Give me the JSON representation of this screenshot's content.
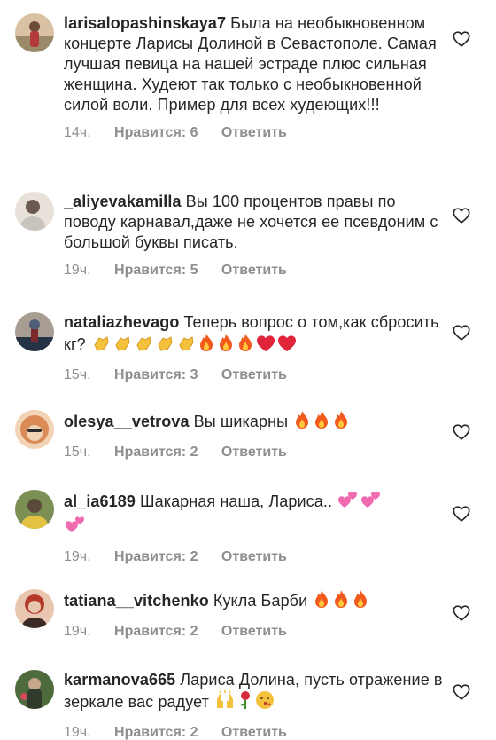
{
  "comments": [
    {
      "username": "larisalopashinskaya7",
      "text": "Была на необыкновенном концерте Ларисы Долиной в Севастополе. Самая лучшая певица на нашей эстраде плюс сильная женщина. Худеют так только с необыкновенной силой воли. Пример для всех худеющих!!!",
      "time": "14ч.",
      "likes": "Нравится: 6",
      "reply": "Ответить",
      "avatar_colors": [
        "#b08f6a",
        "#6c4a3a",
        "#d9c2a4"
      ]
    },
    {
      "username": "_aliyevakamilla",
      "text": "Вы 100 процентов правы по поводу карнавал,даже не хочется ее псевдоним с большой буквы писать.",
      "time": "19ч.",
      "likes": "Нравится: 5",
      "reply": "Ответить",
      "avatar_colors": [
        "#c9c3bd",
        "#6a5a52",
        "#e8e1da"
      ]
    },
    {
      "username": "nataliazhevago",
      "text": "Теперь вопрос о том,как сбросить кг?",
      "time": "15ч.",
      "likes": "Нравится: 3",
      "reply": "Ответить",
      "emojis": [
        "clap-emoji",
        "clap-emoji",
        "clap-emoji",
        "clap-emoji",
        "clap-emoji",
        "fire-emoji",
        "fire-emoji",
        "fire-emoji",
        "red-heart-emoji",
        "red-heart-emoji"
      ],
      "avatar_colors": [
        "#4f5e78",
        "#a79d92",
        "#263246"
      ]
    },
    {
      "username": "olesya__vetrova",
      "text": "Вы шикарны",
      "time": "15ч.",
      "likes": "Нравится: 2",
      "reply": "Ответить",
      "emojis": [
        "fire-emoji",
        "fire-emoji",
        "fire-emoji"
      ],
      "avatar_colors": [
        "#d98a55",
        "#f2d3b6",
        "#2a2a2a"
      ]
    },
    {
      "username": "al_ia6189",
      "text": "Шакарная наша, Лариса..",
      "time": "19ч.",
      "likes": "Нравится: 2",
      "reply": "Ответить",
      "emojis": [
        "two-hearts-emoji",
        "two-hearts-emoji",
        "two-hearts-emoji"
      ],
      "avatar_colors": [
        "#7c8f55",
        "#e2c240",
        "#5b4a3a"
      ]
    },
    {
      "username": "tatiana__vitchenko",
      "text": "Кукла Барби",
      "time": "19ч.",
      "likes": "Нравится: 2",
      "reply": "Ответить",
      "emojis": [
        "fire-emoji",
        "fire-emoji",
        "fire-emoji"
      ],
      "avatar_colors": [
        "#b53a2c",
        "#e9c6b0",
        "#3b2a26"
      ]
    },
    {
      "username": "karmanova665",
      "text": "Лариса Долина, пусть отражение в зеркале вас радует",
      "time": "19ч.",
      "likes": "Нравится: 2",
      "reply": "Ответить",
      "emojis": [
        "raised-hands-emoji",
        "rose-emoji",
        "kissing-face-emoji"
      ],
      "avatar_colors": [
        "#4d6b3c",
        "#c7a88a",
        "#2f3a2a"
      ]
    }
  ],
  "icons": {
    "like": "heart-outline-icon"
  },
  "colors": {
    "text": "#262626",
    "meta": "#8e8e8e",
    "heart_outline": "#262626"
  }
}
